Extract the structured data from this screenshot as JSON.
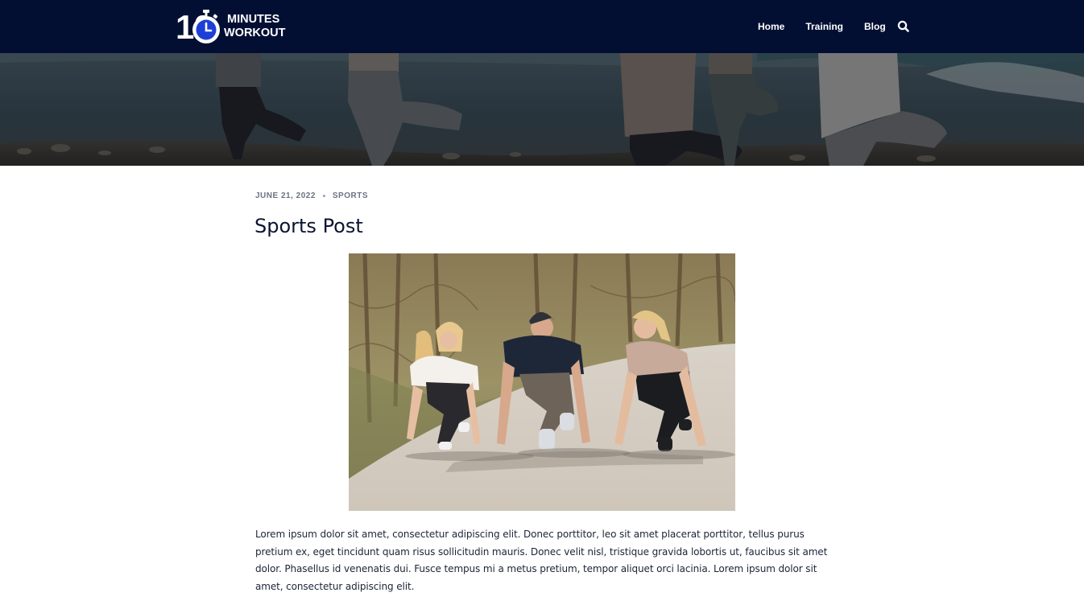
{
  "header": {
    "logo": {
      "digits": "10",
      "line1": "MINUTES",
      "line2": "WORKOUT"
    },
    "nav": [
      {
        "label": "Home"
      },
      {
        "label": "Training"
      },
      {
        "label": "Blog"
      }
    ],
    "search_icon": "search-icon"
  },
  "hero": {
    "image": "yoga-tree-pose-beach-banner"
  },
  "post": {
    "date": "JUNE 21, 2022",
    "category": "SPORTS",
    "title": "Sports Post",
    "image": "three-people-starting-position-forest-path",
    "body": "Lorem ipsum dolor sit amet, consectetur adipiscing elit. Donec porttitor, leo sit amet placerat porttitor, tellus purus pretium ex, eget tincidunt quam risus sollicitudin mauris. Donec velit nisl, tristique gravida lobortis ut, faucibus sit amet dolor. Phasellus id venenatis dui. Fusce tempus mi a metus pretium, tempor aliquet orci lacinia. Lorem ipsum dolor sit amet, consectetur adipiscing elit."
  },
  "colors": {
    "header_bg": "#020f33",
    "logo_blue": "#1e3fd6",
    "text": "#1c2438",
    "meta": "#6b7282"
  }
}
